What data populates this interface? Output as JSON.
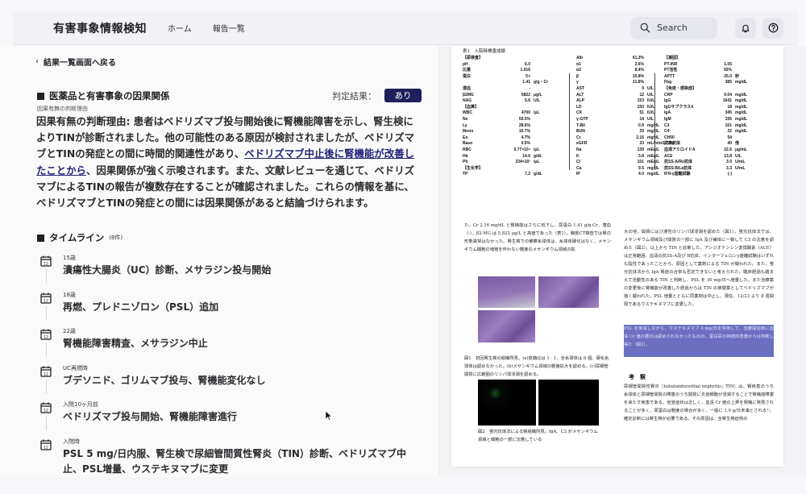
{
  "header": {
    "brand": "有害事象情報検知",
    "nav": [
      "ホーム",
      "報告一覧"
    ],
    "search_placeholder": "Search",
    "icons": [
      "bell-icon",
      "help-icon"
    ]
  },
  "left": {
    "back_link": "結果一覧画面へ戻る",
    "causality": {
      "title": "医薬品と有害事象の因果関係",
      "verdict_label": "判定結果：",
      "verdict_value": "あり",
      "verdict_color": "#1f1f5c",
      "reason_label": "因果有無の判断理由",
      "reason_before": "因果有無の判断理由: 患者はベドリズマブ投与開始後に腎機能障害を示し、腎生検によりTINが診断されました。他の可能性のある原因が検討されましたが、ベドリズマブとTINの発症との間に時間的関連性があり、",
      "reason_link": "ベドリズマブ中止後に腎機能が改善したことから",
      "reason_after": "、因果関係が強く示唆されます。また、文献レビューを通じて、ベドリズマブによるTINの報告が複数存在することが確認されました。これらの情報を基に、ベドリズマブとTINの発症との間には因果関係があると結論づけられます。"
    },
    "timeline": {
      "title": "タイムライン",
      "count": "(8件)",
      "items": [
        {
          "date": "15歳",
          "text": "潰瘍性大腸炎（UC）診断、メサラジン投与開始"
        },
        {
          "date": "18歳",
          "text": "再燃、プレドニゾロン（PSL）追加"
        },
        {
          "date": "22歳",
          "text": "腎機能障害精査、メサラジン中止"
        },
        {
          "date": "UC再燃時",
          "text": "ブデソニド、ゴリムマブ投与、腎機能変化なし"
        },
        {
          "date": "入院10ヶ月前",
          "text": "ベドリズマブ投与開始、腎機能障害進行"
        },
        {
          "date": "入院時",
          "text": "PSL 5 mg/日内服、腎生検で尿細管間質性腎炎（TIN）診断、ベドリズマブ中止、PSL増量、ウステキヌマブに変更"
        }
      ]
    }
  },
  "document": {
    "table_caption": "表1　入院時検査成績",
    "col1": [
      {
        "h": "【尿検査】"
      },
      {
        "n": "pH",
        "v": "6.0",
        "u": ""
      },
      {
        "n": "比重",
        "v": "1.016",
        "u": ""
      },
      {
        "n": "蛋白",
        "v": "5+",
        "u": ""
      },
      {
        "n": "",
        "v": "1.41",
        "u": "g/g・Cr"
      },
      {
        "n": "潜血",
        "v": "-",
        "u": ""
      },
      {
        "n": "β2MG",
        "v": "5822",
        "u": "μg/L"
      },
      {
        "n": "NAG",
        "v": "5.6",
        "u": "U/L"
      },
      {
        "h": "【血算】"
      },
      {
        "n": "WBC",
        "v": "4700",
        "u": "/μL"
      },
      {
        "n": "Ne",
        "v": "55.5%",
        "u": ""
      },
      {
        "n": "Ly",
        "v": "28.6%",
        "u": ""
      },
      {
        "n": "Mono",
        "v": "10.7%",
        "u": ""
      },
      {
        "n": "Eo",
        "v": "4.7%",
        "u": ""
      },
      {
        "n": "Baso",
        "v": "0.5%",
        "u": ""
      },
      {
        "n": "RBC",
        "v": "5.77×10⁶",
        "u": "/μL"
      },
      {
        "n": "Hb",
        "v": "14.6",
        "u": "g/dL"
      },
      {
        "n": "Plt",
        "v": "234×10³",
        "u": "/μL"
      },
      {
        "h": "【生化学】"
      },
      {
        "n": "TP",
        "v": "7.2",
        "u": "g/dL"
      }
    ],
    "col2": [
      {
        "n": "Alb",
        "v": "61.3%",
        "u": ""
      },
      {
        "n": "α1",
        "v": "2.6%",
        "u": ""
      },
      {
        "n": "α2",
        "v": "8.4%",
        "u": ""
      },
      {
        "n": "β",
        "v": "15.8%",
        "u": ""
      },
      {
        "n": "γ",
        "v": "11.8%",
        "u": ""
      },
      {
        "n": "AST",
        "v": "9",
        "u": "U/L"
      },
      {
        "n": "ALT",
        "v": "12",
        "u": "U/L"
      },
      {
        "n": "ALP",
        "v": "153",
        "u": "IU/L"
      },
      {
        "n": "LD",
        "v": "150",
        "u": "IU/L"
      },
      {
        "n": "CK",
        "v": "51",
        "u": "IU/L"
      },
      {
        "n": "γ-GTP",
        "v": "14",
        "u": "U/L"
      },
      {
        "n": "T-Bil",
        "v": "0.9",
        "u": "mg/dL"
      },
      {
        "n": "BUN",
        "v": "29",
        "u": "mg/dL"
      },
      {
        "n": "Cr",
        "v": "2.16",
        "u": "mg/dL"
      },
      {
        "n": "eGFR",
        "v": "33",
        "u": "mL/min/1.73m²"
      },
      {
        "n": "Na",
        "v": "139",
        "u": "mEq/L"
      },
      {
        "n": "K",
        "v": "3.8",
        "u": "mEq/L"
      },
      {
        "n": "Cl",
        "v": "101",
        "u": "mEq/L"
      },
      {
        "n": "Ca",
        "v": "9.5",
        "u": "mg/dL"
      },
      {
        "n": "IP",
        "v": "4.0",
        "u": "mg/dL"
      }
    ],
    "col3": [
      {
        "h": "【凝固】"
      },
      {
        "n": "PT-INR",
        "v": "1.05",
        "u": ""
      },
      {
        "n": "PT活性",
        "v": "92%",
        "u": ""
      },
      {
        "n": "APTT",
        "v": "25.0",
        "u": "秒"
      },
      {
        "n": "Fbg",
        "v": "385",
        "u": "mg/dL"
      },
      {
        "h": "【免疫・感染症】"
      },
      {
        "n": "CRP",
        "v": "0.04",
        "u": "mg/dL"
      },
      {
        "n": "IgG",
        "v": "1641",
        "u": "mg/dL"
      },
      {
        "n": "IgGサブクラス4",
        "v": "18",
        "u": "mg/dL"
      },
      {
        "n": "IgA",
        "v": "345",
        "u": "mg/dL"
      },
      {
        "n": "IgM",
        "v": "156",
        "u": "mg/dL"
      },
      {
        "n": "C3",
        "v": "101",
        "u": "mg/dL"
      },
      {
        "n": "C4",
        "v": "22",
        "u": "mg/dL"
      },
      {
        "n": "CH50",
        "v": "54",
        "u": ""
      },
      {
        "n": "抗核抗体",
        "v": "40",
        "u": "倍"
      },
      {
        "n": "血清アミロイドA",
        "v": "22.6",
        "u": "μg/mL"
      },
      {
        "n": "ACE",
        "v": "13.8",
        "u": "U/L"
      },
      {
        "n": "抗SS-A/Ro抗体",
        "v": "3.0",
        "u": "U/mL"
      },
      {
        "n": "抗SS-B/La抗体",
        "v": "3.3",
        "u": "U/mL"
      },
      {
        "n": "IFN-γ遊離試験",
        "v": "(-)",
        "u": ""
      }
    ],
    "left_para": "た。Cr 2.16 mg/dL と腎機能はさらに低下し、尿蛋白 1.41 g/g·Cr、潜血（-）、β2-MG は 5,822 μg/L と高値であった（表1）。胸部CT検査では腎の形態異常はなかった。腎生検での観察糸球体は、糸球体硬化はなく、メサンギウム細胞の増殖を伴わない軽度のメサンギウム領域の拡",
    "fig1_caption": "図1　初回腎生検の組織所見。(a)皮髄比は 1：1、全糸球体は 8 個、硬化糸球体は認めなかった。(b)メサンギウム領域の軽度拡大を認める。(c)尿細管間質に広範囲のリンパ球浸潤を認める。",
    "fig2_caption": "図2　蛍光抗体法による腎組織所見。IgA、C3 がメサンギウム領域と細胞の一部に沈着している",
    "right_para": "大の他、間質にはび漫性のリンパ球浸潤を認めた（図1）。蛍光抗体法では、メサンギウム領域及び間質の一部に IgA 及び補体に一致して C3 の沈着を認めた（図2）。以上から TIN と診断した。アンジオテンシン変換酵素（ACE）は正常範囲、血清の抗SS-A及び B抗体、インターフェロンγ遊離試験はいずれも陰性であったことから、原因として薬剤による TIN が疑われた。また、蛍光抗体法から IgA 腎症の合併も否定できないと考えられた。臨床経過も踏まえて活動性のある TIN と判断し、PSL を 30 mg/日へ増量した。また治療薬の変更後に腎機能が改善した経過からは TIN の被疑薬としてベドリズマブが強く疑われた。PSL 増量とともに同薬剤は中止し、現在、12/23 より 8 週間隔であるウステキヌマブに変更した。",
    "right_para_hl": "PSL を漸減しながら、ウステキヌマブ 4 mg/日を併用して、治療開始後に血清 Cr 値の悪化は認められなかったものの、蛋白尿の持続的改善からは判断し得た（図3）。",
    "discussion_title": "考　察",
    "discussion_text": "尿細管間質性腎炎（tubulointerstitial nephritis；TIN）は、腎疾患のうち糸球体と尿細管間質の障害のうち間質に炎症細胞が浸潤することで腎機能障害を来たす疾患である。自覚症状は乏しく、血清 Cr 値の上昇を契機に発見されることが多く、尿蛋白は軽度の場合が多く、一般に 1.0 g/日未満とされる¹⁾。確定診断には腎生検が必要である。その原因は、全腎生検症例の"
  }
}
